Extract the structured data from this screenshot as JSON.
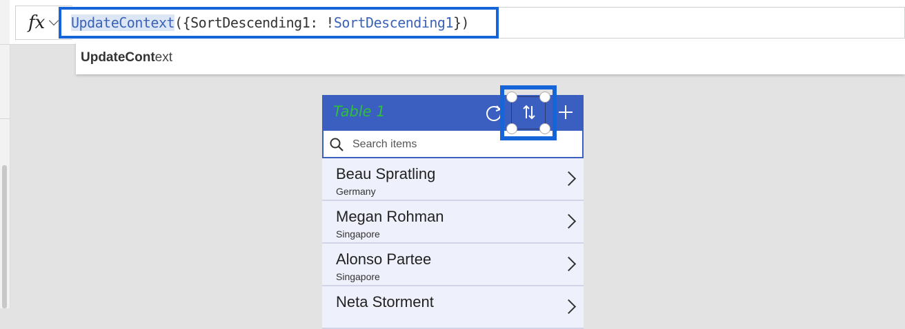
{
  "formula_bar": {
    "fx_label": "fx",
    "formula_fn": "UpdateContext",
    "formula_open": "({SortDescending1: !",
    "formula_ref": "SortDescending1",
    "formula_close": "})"
  },
  "autocomplete": {
    "match": "UpdateCont",
    "rest": "ext"
  },
  "app": {
    "title": "Table 1",
    "search_placeholder": "Search items",
    "items": [
      {
        "name": "Beau Spratling",
        "country": "Germany"
      },
      {
        "name": "Megan Rohman",
        "country": "Singapore"
      },
      {
        "name": "Alonso Partee",
        "country": "Singapore"
      },
      {
        "name": "Neta Storment",
        "country": ""
      }
    ]
  },
  "colors": {
    "highlight": "#1565d8",
    "header": "#3b5fc0",
    "title": "#2fbf3a",
    "list_bg": "#eef0fb"
  }
}
